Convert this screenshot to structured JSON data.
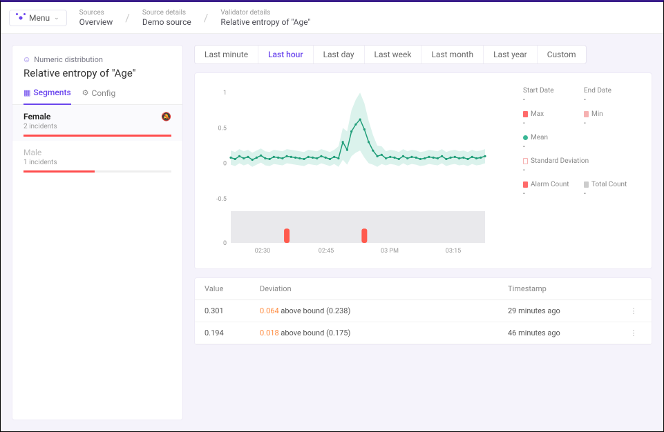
{
  "menu_label": "Menu",
  "breadcrumbs": [
    {
      "small": "Sources",
      "big": "Overview"
    },
    {
      "small": "Source details",
      "big": "Demo source"
    },
    {
      "small": "Validator details",
      "big": "Relative entropy of \"Age\""
    }
  ],
  "validator": {
    "type_label": "Numeric distribution",
    "title": "Relative entropy of \"Age\""
  },
  "side_tabs": [
    {
      "icon": "segments-icon",
      "label": "Segments",
      "active": true
    },
    {
      "icon": "config-icon",
      "label": "Config",
      "active": false
    }
  ],
  "segments": [
    {
      "name": "Female",
      "incidents": "2 incidents",
      "fill": 100,
      "active": true,
      "muted": false
    },
    {
      "name": "Male",
      "incidents": "1 incidents",
      "fill": 48,
      "active": false,
      "muted": true
    }
  ],
  "time_tabs": [
    "Last minute",
    "Last hour",
    "Last day",
    "Last week",
    "Last month",
    "Last year",
    "Custom"
  ],
  "time_tab_active": 1,
  "stats": {
    "start_date": {
      "label": "Start Date",
      "value": "-"
    },
    "end_date": {
      "label": "End Date",
      "value": "-"
    },
    "max": {
      "label": "Max",
      "value": "-",
      "pip": "red"
    },
    "min": {
      "label": "Min",
      "value": "-",
      "pip": "rose"
    },
    "mean": {
      "label": "Mean",
      "value": "-",
      "pip": "green"
    },
    "std": {
      "label": "Standard Deviation",
      "value": "-",
      "pip": "outline"
    },
    "alarm": {
      "label": "Alarm Count",
      "value": "-",
      "pip": "red"
    },
    "total": {
      "label": "Total Count",
      "value": "-",
      "pip": "grey"
    }
  },
  "table": {
    "headers": [
      "Value",
      "Deviation",
      "Timestamp"
    ],
    "rows": [
      {
        "value": "0.301",
        "dev_num": "0.064",
        "dev_text": " above bound (0.238)",
        "ts": "29 minutes ago"
      },
      {
        "value": "0.194",
        "dev_num": "0.018",
        "dev_text": " above bound (0.175)",
        "ts": "46 minutes ago"
      }
    ]
  },
  "chart_data": {
    "type": "line",
    "xlabel": "",
    "ylabel": "",
    "y_ticks": [
      -0.5,
      0,
      0.5,
      1
    ],
    "x_ticks": [
      "02:30",
      "02:45",
      "03 PM",
      "03:15"
    ],
    "ylim": [
      -0.6,
      1.1
    ],
    "series": [
      {
        "name": "mean",
        "values": [
          0.08,
          0.06,
          0.1,
          0.07,
          0.09,
          0.05,
          0.08,
          0.11,
          0.07,
          0.06,
          0.09,
          0.08,
          0.07,
          0.1,
          0.09,
          0.08,
          0.07,
          0.06,
          0.09,
          0.08,
          0.07,
          0.1,
          0.08,
          0.06,
          0.09,
          0.07,
          0.3,
          0.19,
          0.45,
          0.55,
          0.62,
          0.48,
          0.3,
          0.18,
          0.1,
          0.12,
          0.07,
          0.09,
          0.08,
          0.06,
          0.1,
          0.07,
          0.09,
          0.08,
          0.06,
          0.07,
          0.09,
          0.08,
          0.07,
          0.1,
          0.06,
          0.08,
          0.09,
          0.07,
          0.08,
          0.06,
          0.09,
          0.07,
          0.08,
          0.1
        ]
      },
      {
        "name": "band_upper",
        "values": [
          0.18,
          0.16,
          0.2,
          0.17,
          0.19,
          0.15,
          0.18,
          0.21,
          0.17,
          0.16,
          0.19,
          0.18,
          0.17,
          0.2,
          0.19,
          0.18,
          0.17,
          0.16,
          0.19,
          0.18,
          0.17,
          0.2,
          0.18,
          0.16,
          0.19,
          0.24,
          0.5,
          0.45,
          0.75,
          0.9,
          1.0,
          0.85,
          0.6,
          0.4,
          0.25,
          0.24,
          0.17,
          0.19,
          0.18,
          0.16,
          0.2,
          0.17,
          0.19,
          0.18,
          0.16,
          0.17,
          0.19,
          0.18,
          0.17,
          0.2,
          0.16,
          0.18,
          0.19,
          0.17,
          0.18,
          0.16,
          0.19,
          0.17,
          0.18,
          0.2
        ]
      },
      {
        "name": "band_lower",
        "values": [
          -0.02,
          -0.04,
          0.0,
          -0.03,
          -0.01,
          -0.05,
          -0.02,
          0.01,
          -0.03,
          -0.04,
          -0.01,
          -0.02,
          -0.03,
          0.0,
          -0.01,
          -0.02,
          -0.03,
          -0.04,
          -0.01,
          -0.02,
          -0.03,
          0.0,
          -0.02,
          -0.04,
          -0.01,
          -0.05,
          0.05,
          -0.02,
          0.1,
          0.15,
          0.18,
          0.08,
          0.0,
          -0.02,
          -0.05,
          -0.01,
          -0.03,
          -0.01,
          -0.02,
          -0.04,
          0.0,
          -0.03,
          -0.01,
          -0.02,
          -0.04,
          -0.03,
          -0.01,
          -0.02,
          -0.03,
          0.0,
          -0.04,
          -0.02,
          -0.01,
          -0.03,
          -0.02,
          -0.04,
          -0.01,
          -0.03,
          -0.02,
          0.0
        ]
      }
    ],
    "alarm_bar": {
      "y_ticks": [
        0
      ],
      "bars": [
        {
          "x_index": 13,
          "height": 1
        },
        {
          "x_index": 31,
          "height": 1
        }
      ],
      "n_slots": 60
    }
  }
}
